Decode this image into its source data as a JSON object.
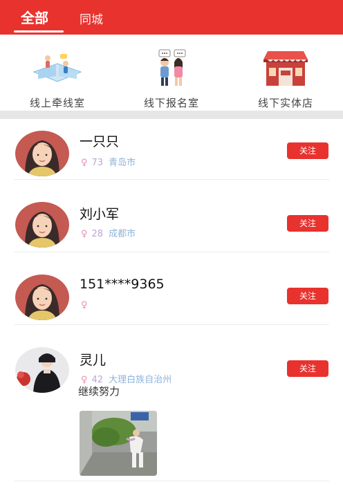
{
  "tabs": {
    "all": "全部",
    "local": "同城"
  },
  "categories": [
    {
      "label": "线上牵线室",
      "icon": "online-matchmaking-icon"
    },
    {
      "label": "线下报名室",
      "icon": "offline-signup-icon"
    },
    {
      "label": "线下实体店",
      "icon": "physical-store-icon"
    }
  ],
  "users": [
    {
      "name": "一只只",
      "age": "73",
      "city": "青岛市",
      "follow": "关注",
      "motto": ""
    },
    {
      "name": "刘小军",
      "age": "28",
      "city": "成都市",
      "follow": "关注",
      "motto": ""
    },
    {
      "name": "151****9365",
      "age": "",
      "city": "",
      "follow": "关注",
      "motto": ""
    },
    {
      "name": "灵儿",
      "age": "42",
      "city": "大理白族自治州",
      "follow": "关注",
      "motto": "继续努力"
    }
  ],
  "gender_symbol": "♀",
  "colors": {
    "brand": "#e8322e",
    "female": "#e78db6",
    "age": "#b9a7d4",
    "city": "#8fb4d8"
  }
}
